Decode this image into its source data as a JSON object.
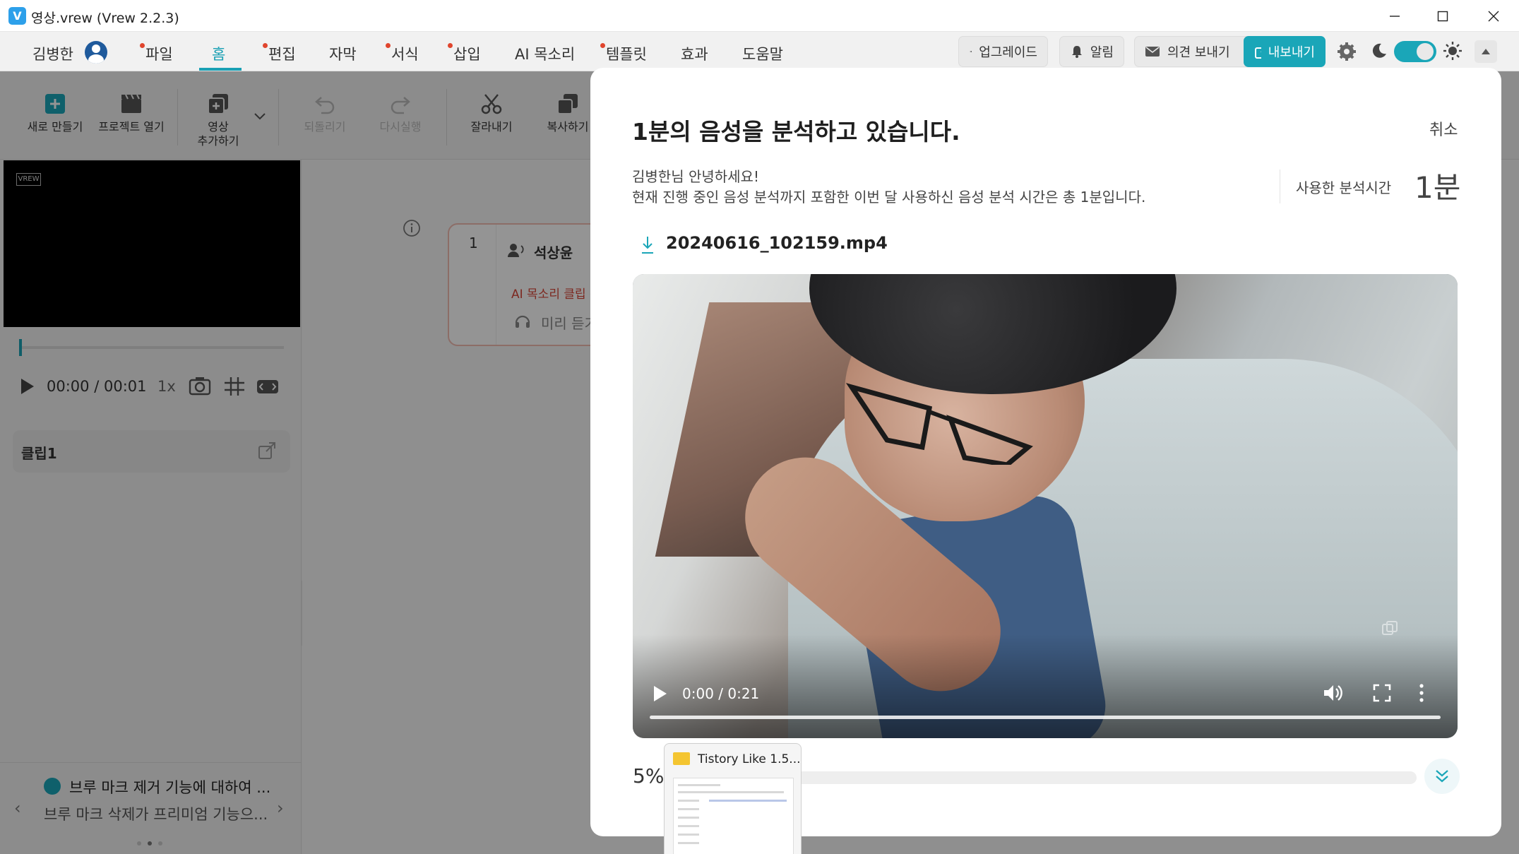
{
  "window": {
    "title": "영상.vrew (Vrew 2.2.3)",
    "app_icon": "V"
  },
  "menubar": {
    "user_name": "김병한",
    "items": [
      "파일",
      "홈",
      "편집",
      "자막",
      "서식",
      "삽입",
      "AI 목소리",
      "템플릿",
      "효과",
      "도움말"
    ],
    "active": "홈",
    "upgrade_label": "업그레이드",
    "alert_label": "알림",
    "feedback_label": "의견 보내기",
    "export_label": "내보내기"
  },
  "toolbar": {
    "new_label": "새로 만들기",
    "open_label": "프로젝트 열기",
    "add_video_label_1": "영상",
    "add_video_label_2": "추가하기",
    "undo_label": "되돌리기",
    "redo_label": "다시실행",
    "cut_label": "잘라내기",
    "copy_label": "복사하기"
  },
  "left_panel": {
    "preview_logo": "VREW",
    "time_current": "00:00",
    "time_total": "/ 00:01",
    "speed": "1x",
    "clip_label": "클립1",
    "notice_title": "브루 마크 제거 기능에 대하여 ...",
    "notice_body": "브루 마크 삭제가 프리미엄 기능으...",
    "notice_page": 2,
    "notice_pages": 3
  },
  "editor": {
    "row_number": "1",
    "speaker": "석상윤",
    "ai_warning": "AI 목소리 클립 편",
    "preview_listen": "미리 듣기"
  },
  "modal": {
    "title": "1분의 음성을 분석하고 있습니다.",
    "cancel_label": "취소",
    "greeting": "김병한님 안녕하세요!",
    "description": "현재 진행 중인 음성 분석까지 포함한 이번 달 사용하신 음성 분석 시간은 총 1분입니다.",
    "used_time_label": "사용한 분석시간",
    "used_time_value": "1분",
    "filename": "20240616_102159.mp4",
    "video_time": "0:00 / 0:21",
    "progress_text": "5%",
    "progress_value": 0.05
  },
  "thumbnail": {
    "title": "Tistory Like 1.5..."
  },
  "colors": {
    "accent": "#1aa6b8",
    "menu_dot": "#e0452d",
    "warning": "#d8473a"
  }
}
